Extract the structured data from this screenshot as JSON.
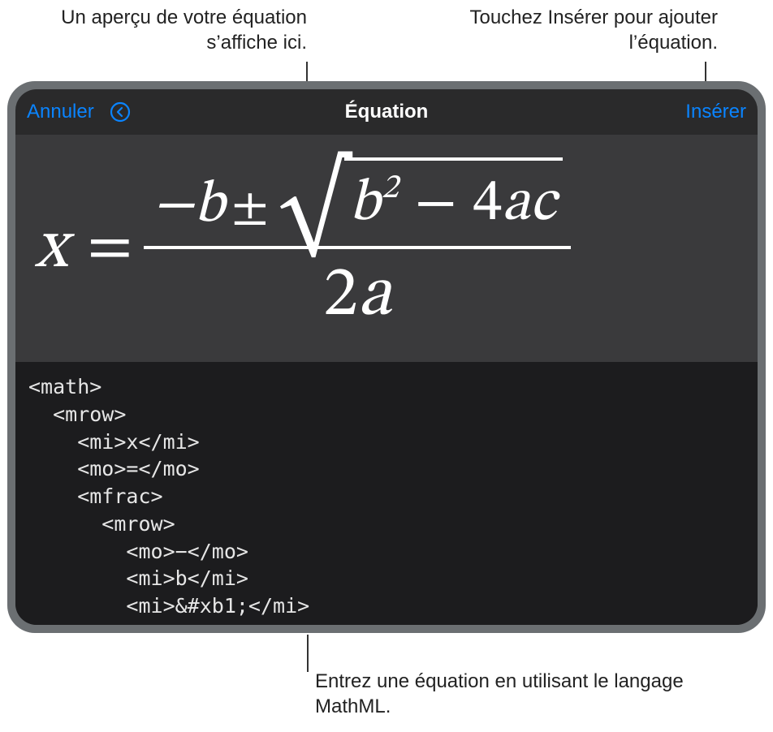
{
  "callouts": {
    "previewHint": "Un aperçu de votre équation s’affiche ici.",
    "insertHint": "Touchez Insérer pour ajouter l’équation.",
    "editorHint": "Entrez une équation en utilisant le langage MathML."
  },
  "toolbar": {
    "cancel": "Annuler",
    "title": "Équation",
    "insert": "Insérer",
    "undoIcon": "undo-icon"
  },
  "equation": {
    "lhs": "x",
    "eq": "=",
    "num_minus": "−",
    "num_b": "b",
    "pm": "±",
    "rad_b": "b",
    "rad_exp": "2",
    "rad_minus": "−",
    "rad_4": "4",
    "rad_a": "a",
    "rad_c": "c",
    "den_2": "2",
    "den_a": "a"
  },
  "editorCode": "<math>\n  <mrow>\n    <mi>x</mi>\n    <mo>=</mo>\n    <mfrac>\n      <mrow>\n        <mo>−</mo>\n        <mi>b</mi>\n        <mi>&#xb1;</mi>"
}
